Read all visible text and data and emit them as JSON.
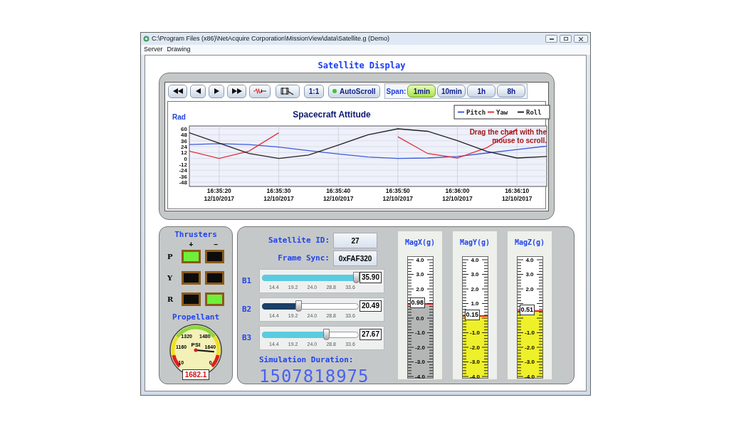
{
  "window": {
    "title": "C:\\Program Files (x86)\\NetAcquire Corporation\\MissionView\\data\\Satellite.g (Demo)"
  },
  "menu": [
    {
      "label": "Server"
    },
    {
      "label": "Drawing"
    }
  ],
  "heading": "Satellite Display",
  "toolbar": {
    "ratio_button": "1:1",
    "autoscroll": {
      "label": "AutoScroll",
      "on": true
    },
    "span_label": "Span:",
    "spans": [
      {
        "label": "1min",
        "selected": true
      },
      {
        "label": "10min",
        "selected": false
      },
      {
        "label": "1h",
        "selected": false
      },
      {
        "label": "8h",
        "selected": false
      }
    ]
  },
  "chart": {
    "note": "Drag the chart with the mouse to scroll.",
    "chart_data": {
      "type": "line",
      "grid": true,
      "legend": "upper right",
      "title": "Spacecraft Attitude",
      "ylabel": "Rad",
      "ylim": [
        -48,
        60
      ],
      "yticks": [
        60,
        48,
        36,
        24,
        12,
        0,
        -12,
        -24,
        -36,
        -48
      ],
      "categories": [
        null,
        "16:35:20 12/10/2017",
        null,
        "16:35:30 12/10/2017",
        null,
        "16:35:40 12/10/2017",
        null,
        "16:35:50 12/10/2017",
        null,
        "16:36:00 12/10/2017",
        null,
        "16:36:10 12/10/2017",
        null
      ],
      "series": [
        {
          "name": "Pitch",
          "color": "#3b5bdb",
          "values": [
            28,
            30,
            28,
            23,
            16,
            9,
            3,
            0,
            1,
            4,
            11,
            18,
            25
          ]
        },
        {
          "name": "Yaw",
          "color": "#e0303a",
          "values": [
            15,
            0,
            15,
            52,
            null,
            null,
            null,
            44,
            10,
            1,
            22,
            60,
            null
          ]
        },
        {
          "name": "Roll",
          "color": "#222222",
          "values": [
            52,
            31,
            10,
            0,
            7,
            27,
            48,
            60,
            55,
            36,
            14,
            1,
            4
          ]
        }
      ]
    }
  },
  "thrusters": {
    "title": "Thrusters",
    "plus": "+",
    "minus": "−",
    "rows": [
      {
        "label": "P",
        "plus_on": true,
        "minus_on": false
      },
      {
        "label": "Y",
        "plus_on": false,
        "minus_on": false
      },
      {
        "label": "R",
        "plus_on": false,
        "minus_on": true
      }
    ]
  },
  "propellant": {
    "title": "Propellant",
    "unit": "PSI",
    "value": "1682.1",
    "labels": [
      "10",
      "1160",
      "1320",
      "1480",
      "1640",
      "0"
    ]
  },
  "fields": [
    {
      "label": "Satellite ID:",
      "value": "27"
    },
    {
      "label": "Frame Sync:",
      "value": "0xFAF320"
    }
  ],
  "sliders": [
    {
      "label": "B1",
      "value": "35.90",
      "level": 0.98,
      "ticks": [
        "14.4",
        "19.2",
        "24.0",
        "28.8",
        "33.6"
      ]
    },
    {
      "label": "B2",
      "value": "20.49",
      "level": 0.38,
      "ticks": [
        "14.4",
        "19.2",
        "24.0",
        "28.8",
        "33.6"
      ]
    },
    {
      "label": "B3",
      "value": "27.67",
      "level": 0.67,
      "ticks": [
        "14.4",
        "19.2",
        "24.0",
        "28.8",
        "33.6"
      ]
    }
  ],
  "duration": {
    "label": "Simulation Duration:",
    "value": "1507818975"
  },
  "mag_gauges": [
    {
      "title": "MagX(g)",
      "value": "0.98",
      "level": 0.62,
      "color": "#b4b6b6",
      "scale": [
        {
          "kind": "label",
          "label": "4.0"
        },
        {
          "kind": "label",
          "label": "3.0"
        },
        {
          "kind": "label",
          "label": "2.0"
        },
        {
          "kind": "gap"
        },
        {
          "kind": "label",
          "label": "0.0"
        },
        {
          "kind": "label",
          "label": "-1.0"
        },
        {
          "kind": "label",
          "label": "-2.0"
        },
        {
          "kind": "label",
          "label": "-3.0"
        },
        {
          "kind": "label",
          "label": "-4.0"
        }
      ]
    },
    {
      "title": "MagY(g)",
      "value": "0.15",
      "level": 0.52,
      "color": "#eef02a",
      "scale": [
        {
          "kind": "label",
          "label": "4.0"
        },
        {
          "kind": "label",
          "label": "3.0"
        },
        {
          "kind": "label",
          "label": "2.0"
        },
        {
          "kind": "label",
          "label": "1.0"
        },
        {
          "kind": "gap"
        },
        {
          "kind": "label",
          "label": "-1.0"
        },
        {
          "kind": "label",
          "label": "-2.0"
        },
        {
          "kind": "label",
          "label": "-3.0"
        },
        {
          "kind": "label",
          "label": "-4.0"
        }
      ]
    },
    {
      "title": "MagZ(g)",
      "value": "0.51",
      "level": 0.56,
      "color": "#eef02a",
      "scale": [
        {
          "kind": "label",
          "label": "4.0"
        },
        {
          "kind": "label",
          "label": "3.0"
        },
        {
          "kind": "label",
          "label": "2.0"
        },
        {
          "kind": "gap"
        },
        {
          "kind": "gap"
        },
        {
          "kind": "label",
          "label": "-1.0"
        },
        {
          "kind": "label",
          "label": "-2.0"
        },
        {
          "kind": "label",
          "label": "-3.0"
        },
        {
          "kind": "label",
          "label": "-4.0"
        }
      ]
    }
  ]
}
